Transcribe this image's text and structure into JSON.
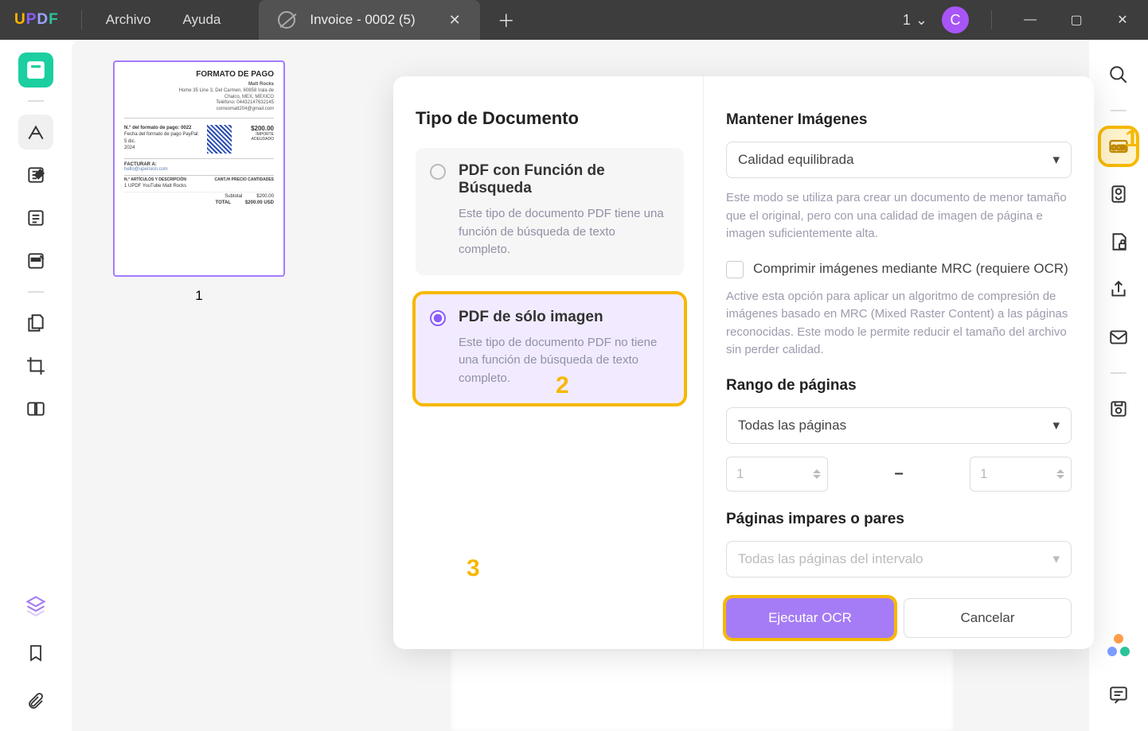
{
  "app": {
    "logo_u": "U",
    "logo_p": "P",
    "logo_d": "D",
    "logo_f": "F"
  },
  "menu": {
    "file": "Archivo",
    "help": "Ayuda"
  },
  "tab": {
    "title": "Invoice - 0002 (5)"
  },
  "titlebar": {
    "page_indicator": "1",
    "avatar_letter": "C"
  },
  "thumbnail": {
    "title": "FORMATO DE PAGO",
    "name": "Matt Rocks",
    "addr1": "Home 35 Line 3, Del Carmen, 60858 Irala de",
    "addr2": "Chalco, MEX, MEXICO",
    "addr3": "Teléfono: 04432147632145",
    "addr4": "correomatt204@gmail.com",
    "pagorow": "N.° del formato de pago: 0022",
    "paydate": "Fecha del formato de pago PayPal: 5 dic.",
    "year": "2024",
    "amt": "$200.00",
    "amt_label": "IMPORTE ADEUDADO",
    "bill_to": "FACTURAR A:",
    "bill_email": "hello@upersion.com",
    "col1": "N.°  ARTÍCULOS Y DESCRIPCIÓN",
    "col2": "CANT./H    PRECIO CANTIDADES",
    "item": "1   UPDF YouTube Matt Rocks",
    "subtotal_lbl": "Subtotal",
    "subtotal_val": "$200.00",
    "total_lbl": "TOTAL",
    "total_val": "$200.00 USD",
    "page_number": "1"
  },
  "ocr": {
    "doc_type_heading": "Tipo de Documento",
    "opt1_title": "PDF con Función de Búsqueda",
    "opt1_desc": "Este tipo de documento PDF tiene una función de búsqueda de texto completo.",
    "opt2_title": "PDF de sólo imagen",
    "opt2_desc": "Este tipo de documento PDF no tiene una función de búsqueda de texto completo.",
    "keep_images": "Mantener Imágenes",
    "quality_value": "Calidad equilibrada",
    "quality_help": "Este modo se utiliza para crear un documento de menor tamaño que el original, pero con una calidad de imagen de página e imagen suficientemente alta.",
    "mrc_label": "Comprimir imágenes mediante MRC (requiere OCR)",
    "mrc_help": "Active esta opción para aplicar un algoritmo de compresión de imágenes basado en MRC (Mixed Raster Content) a las páginas reconocidas. Este modo le permite reducir el tamaño del archivo sin perder calidad.",
    "page_range": "Rango de páginas",
    "range_value": "Todas las páginas",
    "from": "1",
    "to": "1",
    "odd_even": "Páginas impares o pares",
    "odd_even_value": "Todas las páginas del intervalo",
    "run": "Ejecutar OCR",
    "cancel": "Cancelar"
  },
  "callouts": {
    "one": "1",
    "two": "2",
    "three": "3"
  }
}
